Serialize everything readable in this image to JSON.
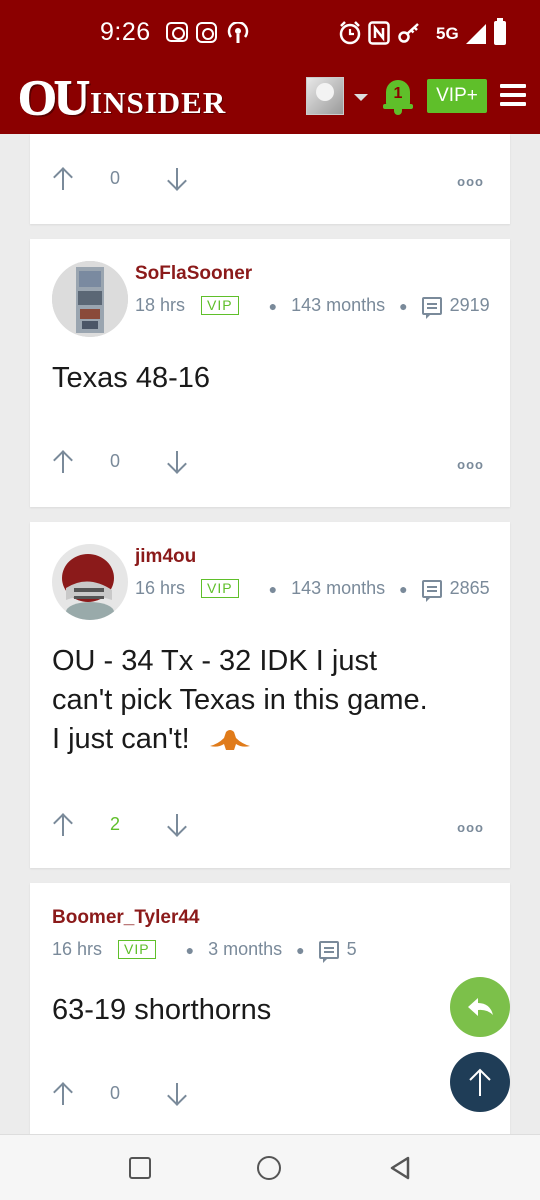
{
  "status_bar": {
    "time": "9:26",
    "network": "5G"
  },
  "header": {
    "logo_ou": "OU",
    "logo_insider": "INSIDER",
    "notification_count": "1",
    "vip_label": "VIP+"
  },
  "posts": [
    {
      "votes": "0",
      "more": "ooo"
    },
    {
      "username": "SoFlaSooner",
      "time": "18 hrs",
      "badge": "VIP",
      "tenure": "143 months",
      "comments": "2919",
      "text": "Texas 48-16",
      "votes": "0",
      "more": "ooo"
    },
    {
      "username": "jim4ou",
      "time": "16 hrs",
      "badge": "VIP",
      "tenure": "143 months",
      "comments": "2865",
      "text_line1": "OU - 34 Tx - 32 IDK I just",
      "text_line2": "can't pick Texas in this game.",
      "text_line3": "I just can't!",
      "votes": "2",
      "more": "ooo"
    },
    {
      "username": "Boomer_Tyler44",
      "time": "16 hrs",
      "badge": "VIP",
      "tenure": "3 months",
      "comments": "5",
      "text": "63-19 shorthorns",
      "votes": "0"
    }
  ],
  "colors": {
    "header_bg": "#8b0000",
    "accent_green": "#5fbf2a",
    "username": "#8b1a1a",
    "fab_dark": "#1f3d57"
  }
}
